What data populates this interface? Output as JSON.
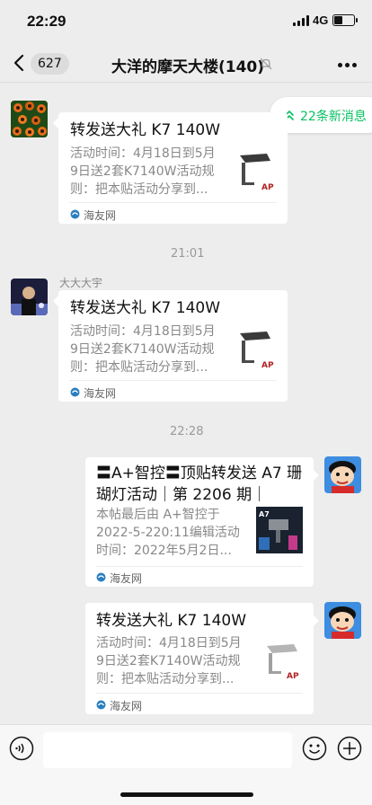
{
  "status_bar": {
    "time": "22:29",
    "network": "4G",
    "battery_level": 0.4
  },
  "nav": {
    "unread_count": "627",
    "title": "大洋的摩天大楼(140)"
  },
  "new_messages_badge": "22条新消息",
  "messages": [
    {
      "title": "转发送大礼 K7 140W",
      "description": "活动时间：4月18日到5月9日送2套K7140W活动规则：把本贴活动分享到...",
      "desc_lines": [
        "活动时间：4月18日到5月",
        "9日送2套K7140W活动规",
        "则：把本贴活动分享到..."
      ],
      "source": "海友网"
    },
    {
      "time": "21:01"
    },
    {
      "sender": "大大大宇",
      "title": "转发送大礼 K7 140W",
      "description": "活动时间：4月18日到5月9日送2套K7140W活动规则：把本贴活动分享到...",
      "desc_lines": [
        "活动时间：4月18日到5月",
        "9日送2套K7140W活动规",
        "则：把本贴活动分享到..."
      ],
      "source": "海友网"
    },
    {
      "time": "22:28"
    },
    {
      "title": "〓A+智控〓顶贴转发送 A7 珊瑚灯活动｜第 2206 期｜",
      "title_lines": [
        "〓A+智控〓顶贴转发送 A7 珊",
        "瑚灯活动｜第 2206 期｜"
      ],
      "description": "本帖最后由 A+智控于 2022-5-220:11编辑活动时间：2022年5月2日...",
      "desc_lines": [
        "本帖最后由 A+智控于",
        "2022-5-220:11编辑活动",
        "时间：2022年5月2日..."
      ],
      "source": "海友网"
    },
    {
      "title": "转发送大礼 K7 140W",
      "description": "活动时间：4月18日到5月9日送2套K7140W活动规则：把本贴活动分享到...",
      "desc_lines": [
        "活动时间：4月18日到5月",
        "9日送2套K7140W活动规",
        "则：把本贴活动分享到..."
      ],
      "source": "海友网"
    }
  ],
  "input": {
    "value": ""
  },
  "colors": {
    "accent": "#07c160",
    "background": "#ededed",
    "bubble": "#ffffff",
    "secondary_text": "#888888"
  }
}
